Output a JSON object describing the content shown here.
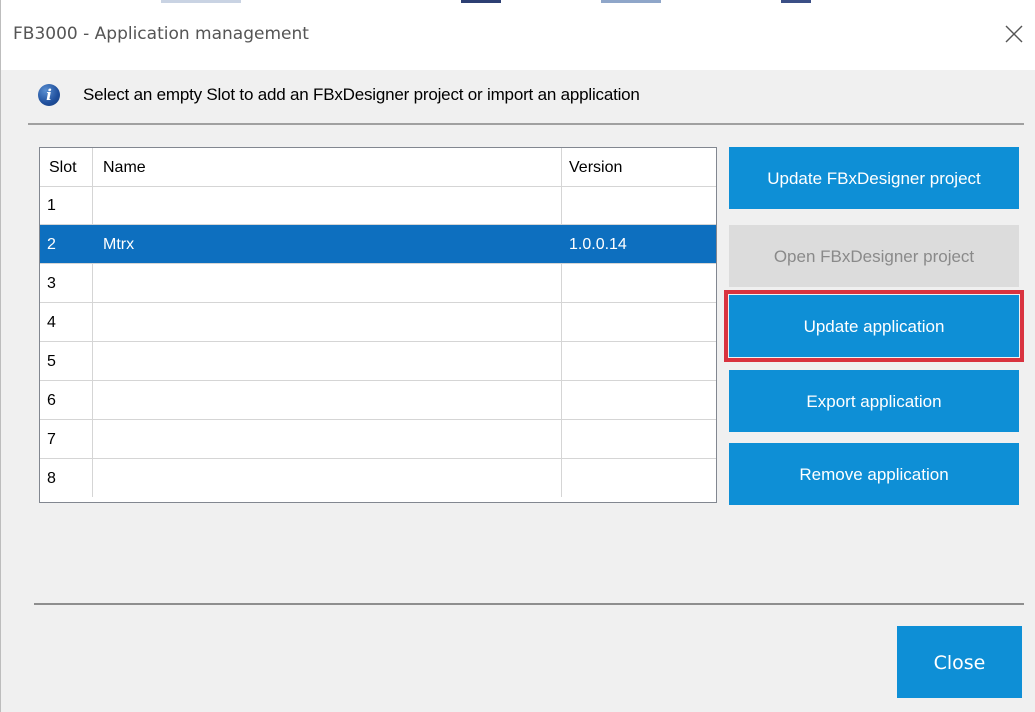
{
  "window": {
    "title": "FB3000 - Application management",
    "close_icon": "close-x-icon"
  },
  "info": {
    "icon": "info-icon",
    "icon_glyph": "i",
    "message": "Select an empty Slot to add an FBxDesigner project or import an application"
  },
  "table": {
    "columns": [
      "Slot",
      "Name",
      "Version"
    ],
    "rows": [
      {
        "slot": "1",
        "name": "",
        "version": "",
        "selected": false
      },
      {
        "slot": "2",
        "name": "Mtrx",
        "version": "1.0.0.14",
        "selected": true
      },
      {
        "slot": "3",
        "name": "",
        "version": "",
        "selected": false
      },
      {
        "slot": "4",
        "name": "",
        "version": "",
        "selected": false
      },
      {
        "slot": "5",
        "name": "",
        "version": "",
        "selected": false
      },
      {
        "slot": "6",
        "name": "",
        "version": "",
        "selected": false
      },
      {
        "slot": "7",
        "name": "",
        "version": "",
        "selected": false
      },
      {
        "slot": "8",
        "name": "",
        "version": "",
        "selected": false
      }
    ]
  },
  "actions": {
    "update_project": "Update FBxDesigner project",
    "open_project": "Open FBxDesigner project",
    "update_application": "Update application",
    "export_application": "Export application",
    "remove_application": "Remove application"
  },
  "footer": {
    "close_label": "Close"
  },
  "colors": {
    "accent": "#0e8fd6",
    "selection": "#0d6fbf",
    "disabled_bg": "#dcdcdc",
    "highlight": "#d9333f"
  }
}
